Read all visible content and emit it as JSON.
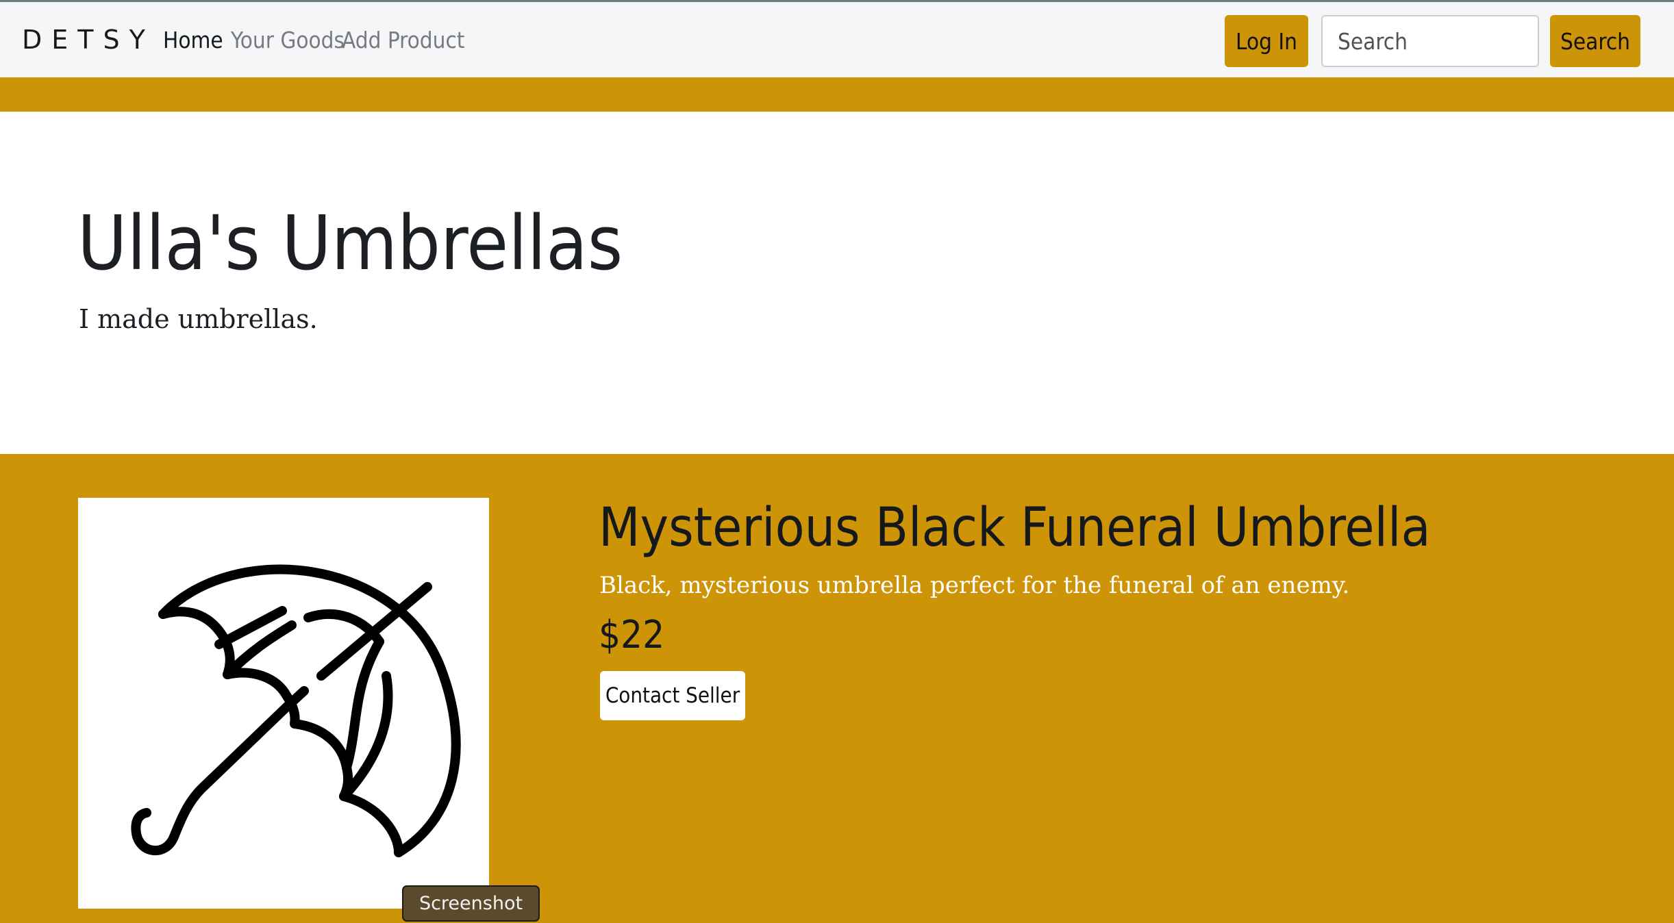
{
  "navbar": {
    "brand": "DETSY",
    "links": [
      {
        "label": "Home",
        "active": true
      },
      {
        "label": "Your Goods",
        "active": false
      },
      {
        "label": "Add Product",
        "active": false
      }
    ],
    "login_label": "Log In",
    "search_placeholder": "Search",
    "search_button_label": "Search"
  },
  "hero": {
    "title": "Ulla's Umbrellas",
    "subtitle": "I made umbrellas."
  },
  "product": {
    "name": "Mysterious Black Funeral Umbrella",
    "description": "Black, mysterious umbrella perfect for the funeral of an enemy.",
    "price": "$22",
    "contact_label": "Contact Seller",
    "image_icon": "umbrella-icon"
  },
  "tooltip": {
    "label": "Screenshot"
  },
  "colors": {
    "accent": "#ce9408",
    "navbar_bg": "#f5f6f8",
    "text_dark": "#15191c"
  }
}
